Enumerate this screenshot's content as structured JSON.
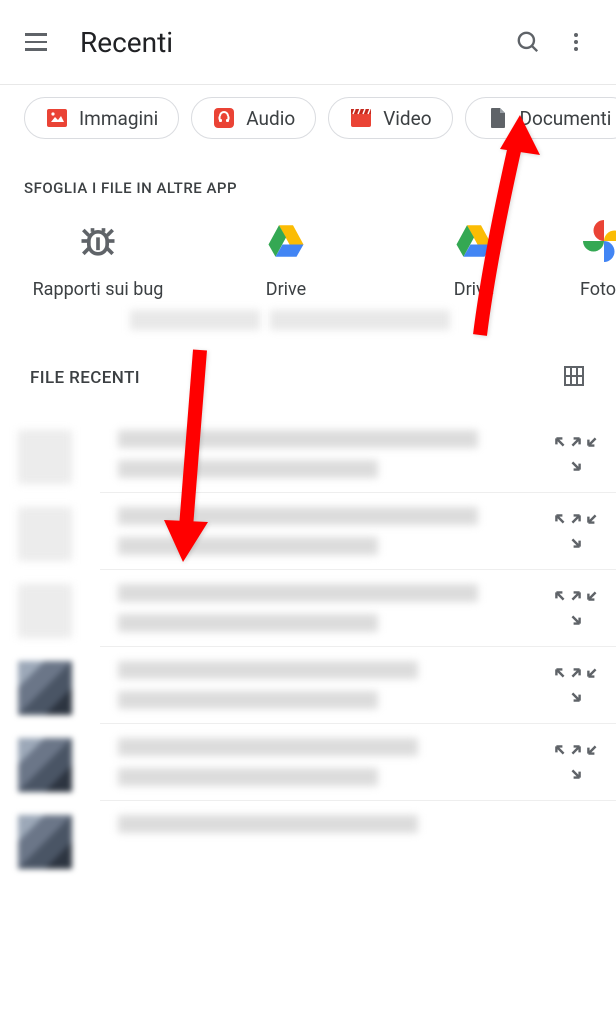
{
  "topbar": {
    "title": "Recenti"
  },
  "chips": [
    {
      "label": "Immagini",
      "icon": "image"
    },
    {
      "label": "Audio",
      "icon": "audio"
    },
    {
      "label": "Video",
      "icon": "video"
    },
    {
      "label": "Documenti",
      "icon": "document"
    }
  ],
  "browse_section": {
    "title": "SFOGLIA I FILE IN ALTRE APP",
    "apps": [
      {
        "label": "Rapporti sui bug",
        "icon": "bug"
      },
      {
        "label": "Drive",
        "icon": "drive"
      },
      {
        "label": "Drive",
        "icon": "drive"
      },
      {
        "label": "Foto",
        "icon": "photos"
      }
    ]
  },
  "recent_files": {
    "title": "FILE RECENTI"
  }
}
